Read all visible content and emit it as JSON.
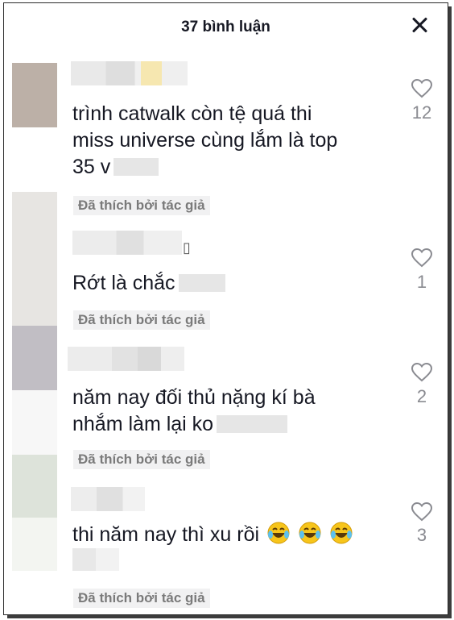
{
  "header": {
    "title": "37 bình luận"
  },
  "comments": [
    {
      "text_lines": [
        "trình catwalk còn tệ quá thi",
        "miss universe cùng lắm là top",
        "35 v"
      ],
      "likes": "12",
      "liked_label": "Đã thích bởi tác giả"
    },
    {
      "text_lines": [
        "Rớt là chắc"
      ],
      "likes": "1",
      "liked_label": "Đã thích bởi tác giả"
    },
    {
      "text_lines": [
        "năm nay đối thủ nặng kí bà",
        "nhắm làm lại ko"
      ],
      "likes": "2",
      "liked_label": "Đã thích bởi tác giả"
    },
    {
      "text_lines": [
        "thi năm nay thì xu rồi"
      ],
      "likes": "3",
      "liked_label": "Đã thích bởi tác giả"
    }
  ],
  "misc": {
    "box_glyph": "▯"
  },
  "colors": {
    "text": "#161823",
    "secondary": "#8a8b91",
    "liked_text": "#7a7a7a",
    "liked_bg": "#f1f1f2"
  }
}
